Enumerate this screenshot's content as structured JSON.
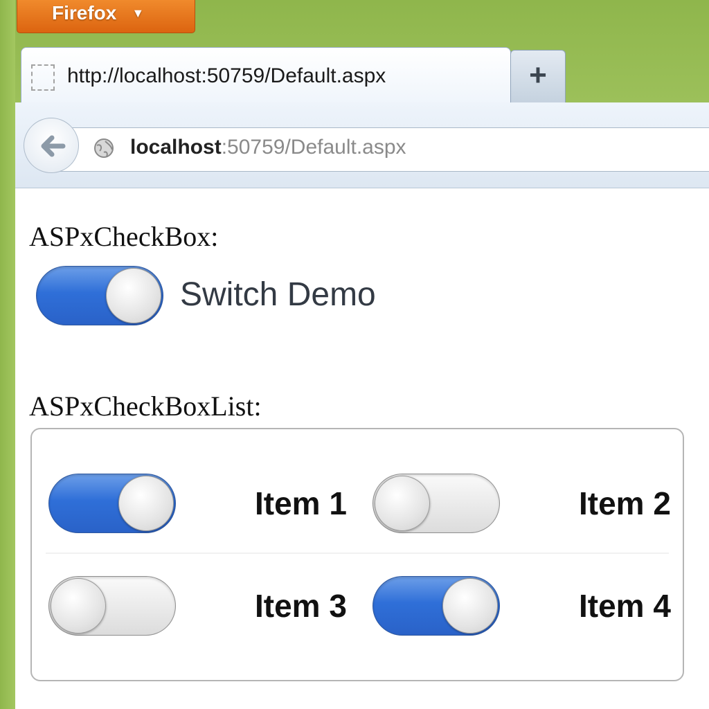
{
  "browser": {
    "app_button_label": "Firefox",
    "app_button_dropdown": "▼",
    "tab": {
      "title": "http://localhost:50759/Default.aspx",
      "favicon": "blank-page-icon"
    },
    "new_tab_label": "+",
    "address_bar": {
      "host": "localhost",
      "path": ":50759/Default.aspx",
      "site_icon": "globe-icon"
    },
    "back_icon": "back-arrow-icon",
    "colors": {
      "frame_green": "#8fb64c",
      "firefox_orange": "#e4731a",
      "switch_on_blue": "#2f6fd8"
    }
  },
  "page": {
    "checkbox_section_label": "ASPxCheckBox:",
    "switch_demo": {
      "label": "Switch Demo",
      "checked": true
    },
    "checkboxlist_section_label": "ASPxCheckBoxList:",
    "checkboxlist_items": [
      {
        "label": "Item 1",
        "checked": true
      },
      {
        "label": "Item 2",
        "checked": false
      },
      {
        "label": "Item 3",
        "checked": false
      },
      {
        "label": "Item 4",
        "checked": true
      }
    ]
  }
}
